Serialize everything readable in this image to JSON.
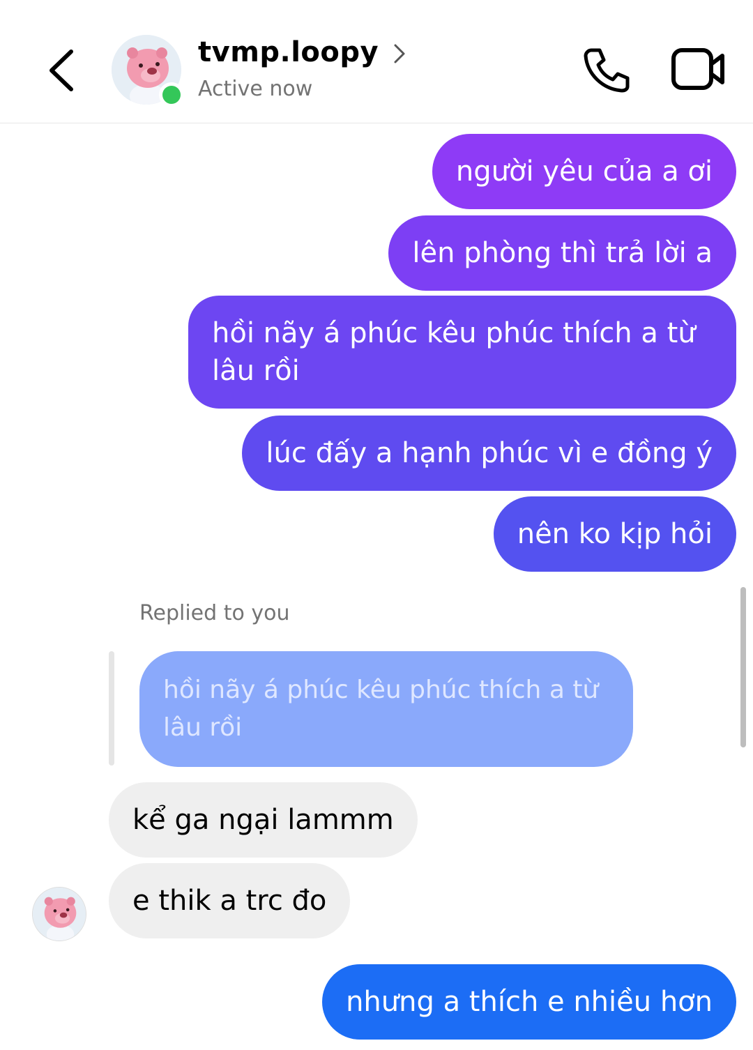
{
  "header": {
    "username": "tvmp.loopy",
    "status": "Active now"
  },
  "messages": [
    {
      "text": "người yêu của a ơi",
      "color": "#8e3bf6"
    },
    {
      "text": "lên phòng thì trả lời a",
      "color": "#7d3ff4"
    },
    {
      "text": "hồi nãy á phúc kêu phúc thích a từ lâu rồi",
      "color": "#6d46f2"
    },
    {
      "text": "lúc đấy a hạnh phúc vì e đồng ý",
      "color": "#5f4bf0"
    },
    {
      "text": "nên ko kịp hỏi",
      "color": "#5452f0"
    }
  ],
  "reply": {
    "label": "Replied to you",
    "quoted": "hồi nãy á phúc kêu phúc thích a từ lâu rồi"
  },
  "received": [
    {
      "text": "kể ga ngại lammm"
    },
    {
      "text": "e thik a trc đo"
    }
  ],
  "last_sent": {
    "text": "nhưng a thích e nhiều hơn",
    "color": "#1c6df5"
  }
}
